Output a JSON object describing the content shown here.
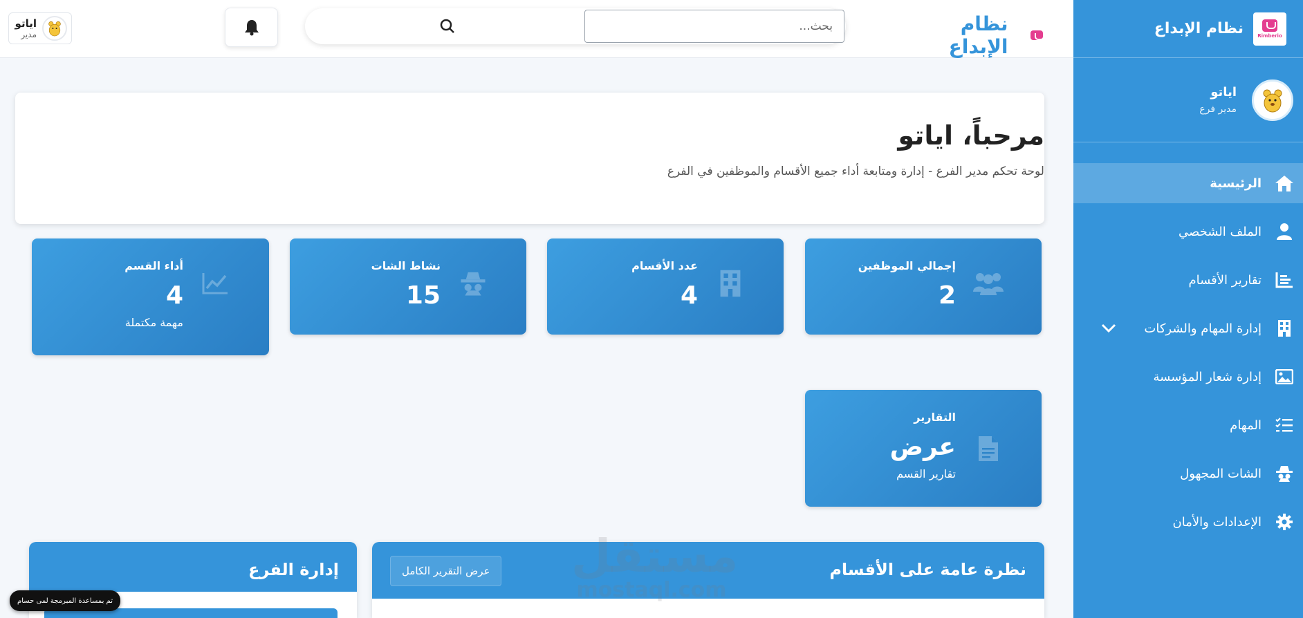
{
  "brand": {
    "name": "نظام الإبداع",
    "logo_text": "Rimberio"
  },
  "user": {
    "name": "اياتو",
    "sidebar_role": "مدير فرع",
    "topbar_role": "مدير"
  },
  "search": {
    "placeholder": "بحث..."
  },
  "sidebar": {
    "items": [
      {
        "label": "الرئيسية",
        "icon": "home-icon",
        "active": true
      },
      {
        "label": "الملف الشخصي",
        "icon": "user-icon"
      },
      {
        "label": "تقارير الأقسام",
        "icon": "chart-icon"
      },
      {
        "label": "إدارة المهام والشركات",
        "icon": "building-icon",
        "has_submenu": true
      },
      {
        "label": "إدارة شعار المؤسسة",
        "icon": "image-icon"
      },
      {
        "label": "المهام",
        "icon": "tasks-icon"
      },
      {
        "label": "الشات المجهول",
        "icon": "incognito-icon"
      },
      {
        "label": "الإعدادات والأمان",
        "icon": "gear-icon"
      }
    ]
  },
  "welcome": {
    "title": "مرحباً، اياتو",
    "subtitle": "لوحة تحكم مدير الفرع - إدارة ومتابعة أداء جميع الأقسام والموظفين في الفرع"
  },
  "stats": {
    "employees": {
      "label": "إجمالي الموظفين",
      "value": "2",
      "icon": "users-icon"
    },
    "departments": {
      "label": "عدد الأقسام",
      "value": "4",
      "icon": "building-icon"
    },
    "chat": {
      "label": "نشاط الشات",
      "value": "15",
      "icon": "incognito-icon"
    },
    "performance": {
      "label": "أداء القسم",
      "value": "4",
      "sub": "مهمة مكتملة",
      "icon": "line-chart-icon"
    },
    "reports": {
      "label": "التقارير",
      "value": "عرض",
      "sub": "تقارير القسم",
      "icon": "file-icon"
    }
  },
  "panels": {
    "overview": {
      "title": "نظرة عامة على الأقسام",
      "button": "عرض التقرير الكامل"
    },
    "branch": {
      "title": "إدارة الفرع"
    }
  },
  "watermark": {
    "ar": "مستقل",
    "en": "mostaql.com"
  },
  "toast": {
    "text": "تم بمساعدة المبرمجة لمى حسام"
  },
  "colors": {
    "primary": "#3594da",
    "background": "#f4f7fb",
    "logo_pink": "#e43d8f"
  }
}
